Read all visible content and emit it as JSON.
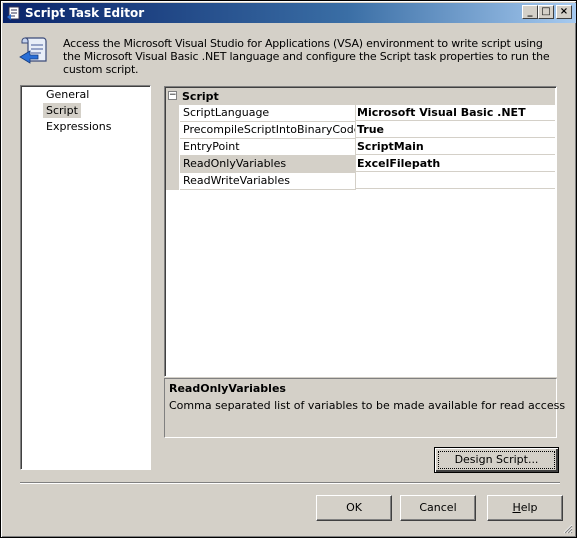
{
  "window": {
    "title": "Script Task Editor",
    "controls": {
      "minimize": "_",
      "maximize": "□",
      "close": "×"
    }
  },
  "header": {
    "icon": "script-scroll-icon",
    "description": "Access the Microsoft Visual Studio for Applications (VSA) environment to write script using the Microsoft Visual Basic .NET language and configure the Script task properties to run the custom script."
  },
  "nav": {
    "items": [
      {
        "label": "General",
        "selected": false
      },
      {
        "label": "Script",
        "selected": true
      },
      {
        "label": "Expressions",
        "selected": false
      }
    ]
  },
  "grid": {
    "category": "Script",
    "expander": "−",
    "rows": [
      {
        "name": "ScriptLanguage",
        "value": "Microsoft Visual Basic .NET"
      },
      {
        "name": "PrecompileScriptIntoBinaryCode",
        "value": "True"
      },
      {
        "name": "EntryPoint",
        "value": "ScriptMain"
      },
      {
        "name": "ReadOnlyVariables",
        "value": "ExcelFilepath",
        "selected": true
      },
      {
        "name": "ReadWriteVariables",
        "value": ""
      }
    ]
  },
  "description": {
    "title": "ReadOnlyVariables",
    "text": "Comma separated list of variables to be made available for read access"
  },
  "buttons": {
    "design_script": "Design Script...",
    "ok": "OK",
    "cancel": "Cancel",
    "help_prefix": "",
    "help_underlined": "H",
    "help_rest": "elp"
  }
}
